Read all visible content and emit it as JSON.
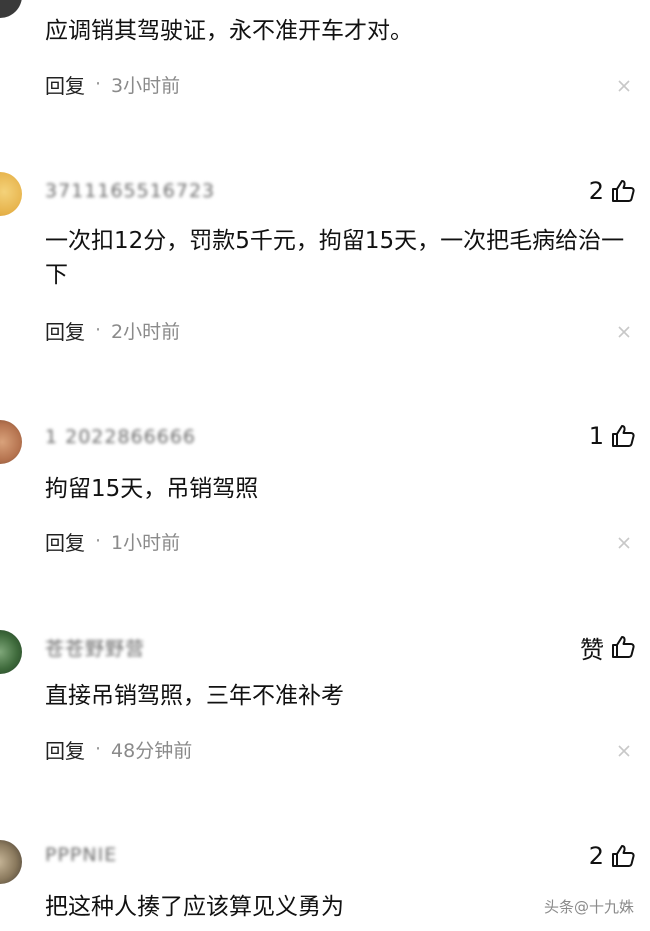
{
  "comments": [
    {
      "username": "",
      "likes": "",
      "text": "应调销其驾驶证，永不准开车才对。",
      "reply_label": "回复",
      "separator": "·",
      "time": "3小时前"
    },
    {
      "username": "3711165516723",
      "likes": "2",
      "text": "一次扣12分，罚款5千元，拘留15天，一次把毛病给治一下",
      "reply_label": "回复",
      "separator": "·",
      "time": "2小时前"
    },
    {
      "username": "1 2022866666",
      "likes": "1",
      "text": "拘留15天，吊销驾照",
      "reply_label": "回复",
      "separator": "·",
      "time": "1小时前"
    },
    {
      "username": "苍苍野野营",
      "likes": "赞",
      "text": "直接吊销驾照，三年不准补考",
      "reply_label": "回复",
      "separator": "·",
      "time": "48分钟前"
    },
    {
      "username": "PPPNIE",
      "likes": "2",
      "text": "把这种人揍了应该算见义勇为",
      "reply_label": "回复",
      "separator": "·",
      "time": ""
    }
  ],
  "watermark": "头条@十九姝",
  "colors": {
    "text": "#111111",
    "meta": "#8a8a8a",
    "close": "#c8c8c8"
  }
}
